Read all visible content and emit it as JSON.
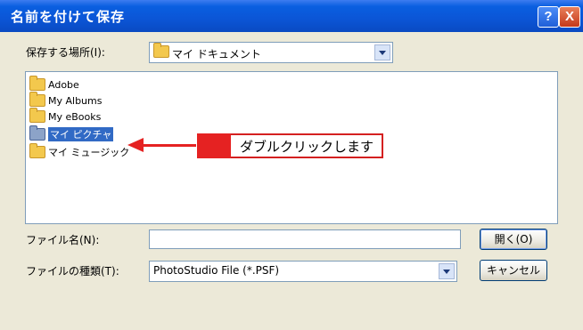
{
  "window": {
    "title": "名前を付けて保存",
    "help_label": "?",
    "close_label": "X"
  },
  "location": {
    "label": "保存する場所(I):",
    "value": "マイ ドキュメント"
  },
  "toolbar": {
    "back_icon": "back-arrow-icon",
    "up_icon": "folder-up-icon",
    "new_folder_icon": "new-folder-icon",
    "view_icon": "view-menu-icon"
  },
  "files": [
    {
      "name": "Adobe",
      "icon": "folder-icon"
    },
    {
      "name": "My Albums",
      "icon": "folder-icon"
    },
    {
      "name": "My eBooks",
      "icon": "folder-icon"
    },
    {
      "name": "マイ ピクチャ",
      "icon": "pictures-folder-icon",
      "selected": true
    },
    {
      "name": "マイ ミュージック",
      "icon": "music-folder-icon"
    }
  ],
  "annotation": {
    "text": "ダブルクリックします",
    "color": "#e52222"
  },
  "filename": {
    "label": "ファイル名(N):",
    "value": ""
  },
  "filetype": {
    "label": "ファイルの種類(T):",
    "value": "PhotoStudio File (*.PSF)"
  },
  "buttons": {
    "open_label": "開く(O)",
    "cancel_label": "キャンセル"
  }
}
